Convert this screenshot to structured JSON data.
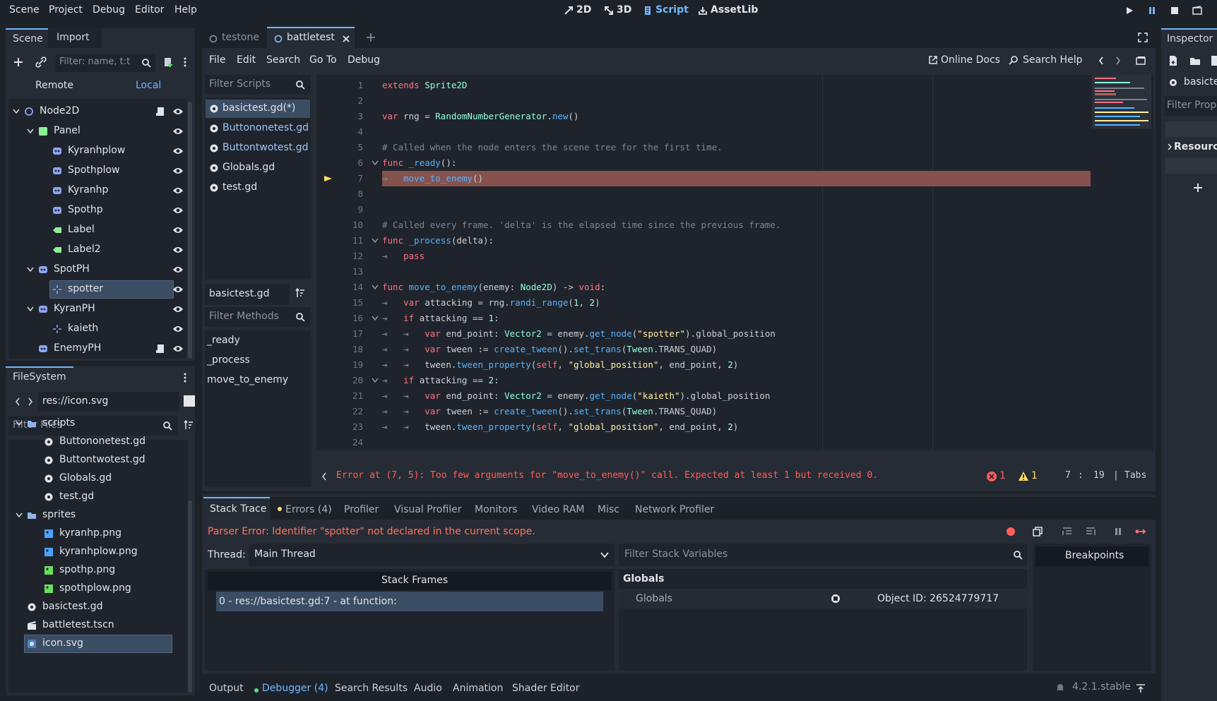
{
  "menu": [
    "Scene",
    "Project",
    "Debug",
    "Editor",
    "Help"
  ],
  "modes": [
    {
      "label": "2D",
      "icon": "2d-icon",
      "active": false
    },
    {
      "label": "3D",
      "icon": "3d-icon",
      "active": false
    },
    {
      "label": "Script",
      "icon": "script-icon",
      "active": true
    },
    {
      "label": "AssetLib",
      "icon": "assetlib-icon",
      "active": false
    }
  ],
  "scene_dock": {
    "tabs": [
      "Scene",
      "Import"
    ],
    "filter_placeholder": "Filter: name, t:t",
    "remote": "Remote",
    "local": "Local",
    "nodes": [
      {
        "label": "Node2D",
        "depth": 0,
        "icon": "node2d-icon"
      },
      {
        "label": "Panel",
        "depth": 1,
        "icon": "panel-icon"
      },
      {
        "label": "Kyranhplow",
        "depth": 2,
        "icon": "sprite-icon"
      },
      {
        "label": "Spothplow",
        "depth": 2,
        "icon": "sprite-icon"
      },
      {
        "label": "Kyranhp",
        "depth": 2,
        "icon": "sprite-icon"
      },
      {
        "label": "Spothp",
        "depth": 2,
        "icon": "sprite-icon"
      },
      {
        "label": "Label",
        "depth": 2,
        "icon": "label-icon"
      },
      {
        "label": "Label2",
        "depth": 2,
        "icon": "label-icon"
      },
      {
        "label": "SpotPH",
        "depth": 1,
        "icon": "sprite-icon"
      },
      {
        "label": "spotter",
        "depth": 2,
        "icon": "marker-icon"
      },
      {
        "label": "KyranPH",
        "depth": 1,
        "icon": "sprite-icon"
      },
      {
        "label": "kaieth",
        "depth": 2,
        "icon": "marker-icon"
      },
      {
        "label": "EnemyPH",
        "depth": 1,
        "icon": "sprite-icon"
      }
    ]
  },
  "filesystem": {
    "title": "FileSystem",
    "path": "res://icon.svg",
    "filter_placeholder": "Filter Files",
    "items": [
      {
        "label": "scripts",
        "depth": 1,
        "icon": "folder-icon"
      },
      {
        "label": "Buttononetest.gd",
        "depth": 2,
        "icon": "gear-icon"
      },
      {
        "label": "Buttontwotest.gd",
        "depth": 2,
        "icon": "gear-icon"
      },
      {
        "label": "Globals.gd",
        "depth": 2,
        "icon": "gear-icon"
      },
      {
        "label": "test.gd",
        "depth": 2,
        "icon": "gear-icon"
      },
      {
        "label": "sprites",
        "depth": 1,
        "icon": "folder-icon"
      },
      {
        "label": "kyranhp.png",
        "depth": 2,
        "icon": "image-icon"
      },
      {
        "label": "kyranhplow.png",
        "depth": 2,
        "icon": "image-icon"
      },
      {
        "label": "spothp.png",
        "depth": 2,
        "icon": "image-icon"
      },
      {
        "label": "spothplow.png",
        "depth": 2,
        "icon": "image-icon"
      },
      {
        "label": "basictest.gd",
        "depth": 1,
        "icon": "gear-icon"
      },
      {
        "label": "battletest.tscn",
        "depth": 1,
        "icon": "scene-icon"
      },
      {
        "label": "icon.svg",
        "depth": 1,
        "icon": "svg-icon"
      }
    ]
  },
  "editor_tabs": [
    "testone",
    "battletest"
  ],
  "script_menu": [
    "File",
    "Edit",
    "Search",
    "Go To",
    "Debug"
  ],
  "online_docs": "Online Docs",
  "search_help": "Search Help",
  "filter_scripts": "Filter Scripts",
  "scripts": [
    "basictest.gd(*)",
    "Buttononetest.gd",
    "Buttontwotest.gd",
    "Globals.gd",
    "test.gd"
  ],
  "current_script": "basictest.gd",
  "filter_methods": "Filter Methods",
  "methods": [
    "_ready",
    "_process",
    "move_to_enemy"
  ],
  "code_line_numbers": [
    "1",
    "2",
    "3",
    "4",
    "5",
    "6",
    "7",
    "8",
    "9",
    "10",
    "11",
    "12",
    "13",
    "14",
    "15",
    "16",
    "17",
    "18",
    "19",
    "20",
    "21",
    "22",
    "23",
    "24"
  ],
  "status": {
    "error_text": "Error at (7, 5): Too few arguments for \"move_to_enemy()\" call. Expected at least 1 but received 0.",
    "errors": "1",
    "warnings": "1",
    "line": "7",
    "col": "19",
    "indent": "Tabs"
  },
  "debugger": {
    "tabs": [
      "Stack Trace",
      "Errors (4)",
      "Profiler",
      "Visual Profiler",
      "Monitors",
      "Video RAM",
      "Misc",
      "Network Profiler"
    ],
    "parser_error": "Parser Error: Identifier \"spotter\" not declared in the current scope.",
    "thread_label": "Thread:",
    "thread_value": "Main Thread",
    "filter_vars": "Filter Stack Variables",
    "breakpoints": "Breakpoints",
    "stack_frames_header": "Stack Frames",
    "stack_frame": "0 - res://basictest.gd:7 - at function:",
    "globals_header": "Globals",
    "globals_row_label": "Globals",
    "globals_row_value": "Object ID: 26524779717"
  },
  "bottom_tabs": [
    "Output",
    "Debugger (4)",
    "Search Results",
    "Audio",
    "Animation",
    "Shader Editor"
  ],
  "version": "4.2.1.stable",
  "inspector": {
    "title": "Inspector",
    "resource_name": "basictes",
    "filter_placeholder": "Filter Prope",
    "resource_label": "Resource"
  },
  "colors": {
    "accent": "#70b7ff",
    "error": "#ff5d5d",
    "warning": "#ffdd65",
    "error_line": "#85524d"
  }
}
